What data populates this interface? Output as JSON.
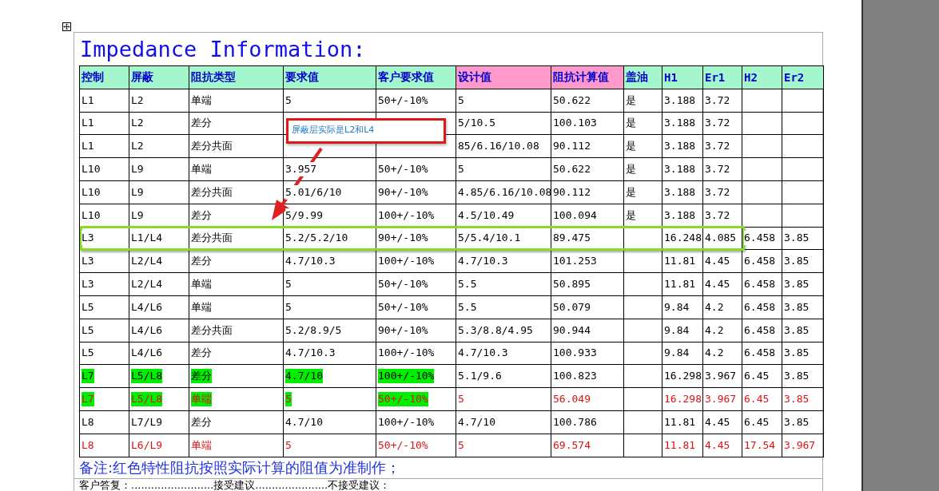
{
  "title": "Impedance Information:",
  "columns": [
    {
      "label": "控制"
    },
    {
      "label": "屏蔽"
    },
    {
      "label": "阻抗类型"
    },
    {
      "label": "要求值"
    },
    {
      "label": "客户要求值"
    },
    {
      "label": "设计值",
      "color": "#ff99cc"
    },
    {
      "label": "阻抗计算值",
      "color": "#ff99cc"
    },
    {
      "label": "盖油"
    },
    {
      "label": "H1"
    },
    {
      "label": "Er1"
    },
    {
      "label": "H2"
    },
    {
      "label": "Er2"
    }
  ],
  "rows": [
    {
      "kind": "normal",
      "cells": [
        "L1",
        "L2",
        "单端",
        "5",
        "50+/-10%",
        "5",
        "50.622",
        "是",
        "3.188",
        "3.72",
        "",
        ""
      ]
    },
    {
      "kind": "normal",
      "cells": [
        "L1",
        "L2",
        "差分",
        "",
        "",
        "5/10.5",
        "100.103",
        "是",
        "3.188",
        "3.72",
        "",
        ""
      ]
    },
    {
      "kind": "normal",
      "cells": [
        "L1",
        "L2",
        "差分共面",
        "",
        "",
        "85/6.16/10.08",
        "90.112",
        "是",
        "3.188",
        "3.72",
        "",
        ""
      ]
    },
    {
      "kind": "normal",
      "cells": [
        "L10",
        "L9",
        "单端",
        "3.957",
        "50+/-10%",
        "5",
        "50.622",
        "是",
        "3.188",
        "3.72",
        "",
        ""
      ]
    },
    {
      "kind": "normal",
      "cells": [
        "L10",
        "L9",
        "差分共面",
        "5.01/6/10",
        "90+/-10%",
        "4.85/6.16/10.08",
        "90.112",
        "是",
        "3.188",
        "3.72",
        "",
        ""
      ]
    },
    {
      "kind": "normal",
      "cells": [
        "L10",
        "L9",
        "差分",
        "5/9.99",
        "100+/-10%",
        "4.5/10.49",
        "100.094",
        "是",
        "3.188",
        "3.72",
        "",
        ""
      ]
    },
    {
      "kind": "normal",
      "cells": [
        "L3",
        "L1/L4",
        "差分共面",
        "5.2/5.2/10",
        "90+/-10%",
        "5/5.4/10.1",
        "89.475",
        "",
        "16.248",
        "4.085",
        "6.458",
        "3.85"
      ]
    },
    {
      "kind": "normal",
      "cells": [
        "L3",
        "L2/L4",
        "差分",
        "4.7/10.3",
        "100+/-10%",
        "4.7/10.3",
        "101.253",
        "",
        "11.81",
        "4.45",
        "6.458",
        "3.85"
      ]
    },
    {
      "kind": "normal",
      "cells": [
        "L3",
        "L2/L4",
        "单端",
        "5",
        "50+/-10%",
        "5.5",
        "50.895",
        "",
        "11.81",
        "4.45",
        "6.458",
        "3.85"
      ]
    },
    {
      "kind": "normal",
      "cells": [
        "L5",
        "L4/L6",
        "单端",
        "5",
        "50+/-10%",
        "5.5",
        "50.079",
        "",
        "9.84",
        "4.2",
        "6.458",
        "3.85"
      ]
    },
    {
      "kind": "normal",
      "cells": [
        "L5",
        "L4/L6",
        "差分共面",
        "5.2/8.9/5",
        "90+/-10%",
        "5.3/8.8/4.95",
        "90.944",
        "",
        "9.84",
        "4.2",
        "6.458",
        "3.85"
      ]
    },
    {
      "kind": "normal",
      "cells": [
        "L5",
        "L4/L6",
        "差分",
        "4.7/10.3",
        "100+/-10%",
        "4.7/10.3",
        "100.933",
        "",
        "9.84",
        "4.2",
        "6.458",
        "3.85"
      ]
    },
    {
      "kind": "green",
      "cells": [
        "L7",
        "L5/L8",
        "差分",
        "4.7/10",
        "100+/-10%",
        "5.1/9.6",
        "100.823",
        "",
        "16.298",
        "3.967",
        "6.45",
        "3.85"
      ]
    },
    {
      "kind": "green-red",
      "cells": [
        "L7",
        "L5/L8",
        "单端",
        "5",
        "50+/-10%",
        "5",
        "56.049",
        "",
        "16.298",
        "3.967",
        "6.45",
        "3.85"
      ]
    },
    {
      "kind": "normal",
      "cells": [
        "L8",
        "L7/L9",
        "差分",
        "4.7/10",
        "100+/-10%",
        "4.7/10",
        "100.786",
        "",
        "11.81",
        "4.45",
        "6.45",
        "3.85"
      ]
    },
    {
      "kind": "red",
      "cells": [
        "L8",
        "L6/L9",
        "单端",
        "5",
        "50+/-10%",
        "5",
        "69.574",
        "",
        "11.81",
        "4.45",
        "17.54",
        "3.967"
      ]
    }
  ],
  "note": "备注:红色特性阻抗按照实际计算的阻值为准制作；",
  "reply": "客户答复：.........................接受建议......................不接受建议：",
  "callout": "屏蔽层实际是L2和L4"
}
